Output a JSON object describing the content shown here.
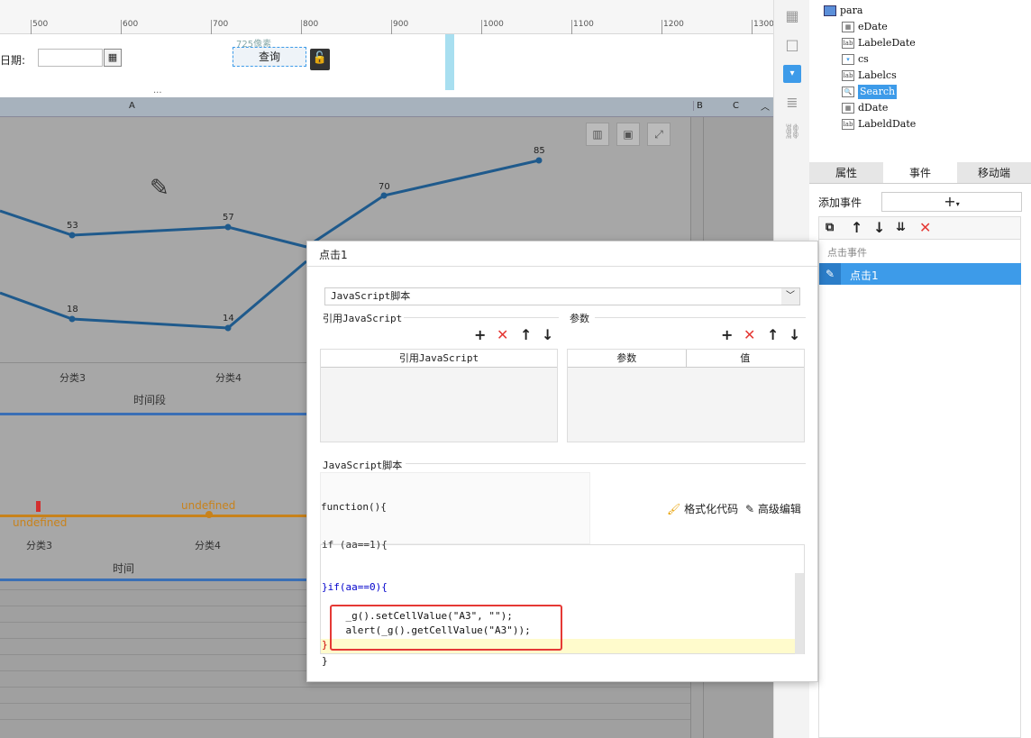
{
  "ruler": {
    "ticks": [
      "500",
      "600",
      "700",
      "800",
      "900",
      "1000",
      "1100",
      "1200",
      "1300"
    ]
  },
  "param_bar": {
    "date_label": "日期:",
    "date_value": "",
    "width_hint": "725像素",
    "query_button": "查询"
  },
  "sheet": {
    "col_a": "A",
    "col_b": "B",
    "col_c": "C"
  },
  "chart1": {
    "chart_data": {
      "type": "line",
      "categories": [
        "分类3",
        "分类4"
      ],
      "series": [
        {
          "values": [
            53,
            57,
            70,
            85
          ]
        },
        {
          "values": [
            18,
            14
          ]
        }
      ],
      "xlabel": "时间段"
    },
    "labels": [
      "53",
      "57",
      "70",
      "85",
      "18",
      "14"
    ],
    "cat3": "分类3",
    "cat4": "分类4",
    "xlabel": "时间段"
  },
  "chart2": {
    "undefined_label": "undefined",
    "cat3": "分类3",
    "cat4": "分类4",
    "xlabel": "时间"
  },
  "tree": {
    "items": [
      "para",
      "eDate",
      "LabeleDate",
      "cs",
      "Labelcs",
      "Search",
      "dDate",
      "LabeldDate"
    ]
  },
  "panel_tabs": [
    "属性",
    "事件",
    "移动端"
  ],
  "events": {
    "add_event_label": "添加事件",
    "section_label": "点击事件",
    "item": "点击1"
  },
  "dialog": {
    "title": "点击1",
    "type_select": "JavaScript脚本",
    "ref_js_section": "引用JavaScript",
    "params_section": "参数",
    "ref_js_col": "引用JavaScript",
    "param_col": "参数",
    "value_col": "值",
    "script_section": "JavaScript脚本",
    "function_sig": "function(){",
    "format_code": "格式化代码",
    "advanced_edit": "高级编辑",
    "code_lines": [
      "if (aa==1){",
      "}if(aa==0){",
      "    _g().setCellValue(\"A3\", \"\");",
      "    alert(_g().getCellValue(\"A3\"));",
      "}",
      "}"
    ]
  },
  "colors": {
    "accent": "#3d9be9",
    "series": "#1f5a8c",
    "orange": "#c8821b",
    "red": "#e53935"
  }
}
